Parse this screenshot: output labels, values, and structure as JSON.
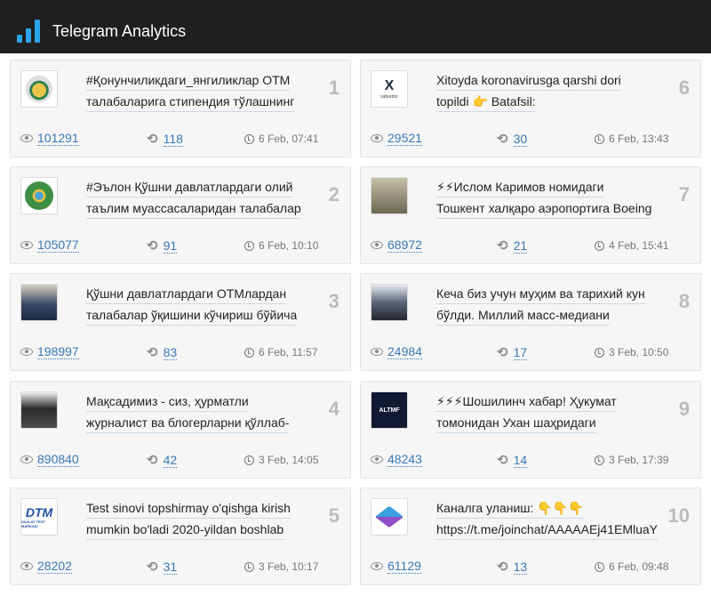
{
  "app": {
    "title": "Telegram Analytics"
  },
  "colors": {
    "topbar": "#1f1f1f",
    "accent": "#2aa3e8",
    "link": "#3a78b8"
  },
  "posts": [
    {
      "rank": "1",
      "avatar": "seal-icon",
      "line1": "#Қонунчиликдаги_янгиликлар ОТМ",
      "line2": "талабаларига стипендия тўлашнинг",
      "views": "101291",
      "reposts": "118",
      "time": "6 Feb, 07:41"
    },
    {
      "rank": "6",
      "avatar": "xabardor-logo-icon",
      "avatar_text": "X",
      "avatar_sub": "xabardor",
      "line1": "Xitoyda koronavirusga qarshi dori",
      "line2": "topildi 👉 Batafsil:",
      "views": "29521",
      "reposts": "30",
      "time": "6 Feb, 13:43"
    },
    {
      "rank": "2",
      "avatar": "emblem-icon",
      "line1": "#Эълон Қўшни давлатлардаги олий",
      "line2": "таълим муассасаларидан талабалар",
      "views": "105077",
      "reposts": "91",
      "time": "6 Feb, 10:10"
    },
    {
      "rank": "7",
      "avatar": "photo-icon",
      "line1": "⚡⚡Ислом Каримов номидаги",
      "line2": "Тошкент халқаро аэропортига Boeing",
      "views": "68972",
      "reposts": "21",
      "time": "4 Feb, 15:41"
    },
    {
      "rank": "3",
      "avatar": "photo-icon",
      "line1": "Қўшни давлатлардаги ОТМлардан",
      "line2": "талабалар ўқишини кўчириш бўйича",
      "views": "198997",
      "reposts": "83",
      "time": "6 Feb, 11:57"
    },
    {
      "rank": "8",
      "avatar": "photo-icon",
      "line1": "Кеча биз учун муҳим ва тарихий кун",
      "line2": "бўлди. Миллий масс-медиани",
      "views": "24984",
      "reposts": "17",
      "time": "3 Feb, 10:50"
    },
    {
      "rank": "4",
      "avatar": "photo-icon",
      "line1": "Мақсадимиз - сиз, ҳурматли",
      "line2": "журналист ва блогерларни қўллаб-",
      "views": "890840",
      "reposts": "42",
      "time": "3 Feb, 14:05"
    },
    {
      "rank": "9",
      "avatar": "altmf-logo-icon",
      "avatar_text": "ALTMF",
      "line1": "⚡⚡⚡Шошилинч хабар! Ҳукумат",
      "line2": "томонидан Ухан шаҳридаги",
      "views": "48243",
      "reposts": "14",
      "time": "3 Feb, 17:39"
    },
    {
      "rank": "5",
      "avatar": "dtm-logo-icon",
      "avatar_text": "DTM",
      "avatar_sub": "DAVLAT TEST MARKAZI",
      "line1": "Test sinovi topshirmay o'qishga kirish",
      "line2": "mumkin bo'ladi 2020-yildan boshlab",
      "views": "28202",
      "reposts": "31",
      "time": "3 Feb, 10:17"
    },
    {
      "rank": "10",
      "avatar": "cube-logo-icon",
      "line1": "Каналга уланиш: 👇👇👇",
      "line2": "https://t.me/joinchat/AAAAAEj41EMluaY",
      "views": "61129",
      "reposts": "13",
      "time": "6 Feb, 09:48"
    }
  ]
}
